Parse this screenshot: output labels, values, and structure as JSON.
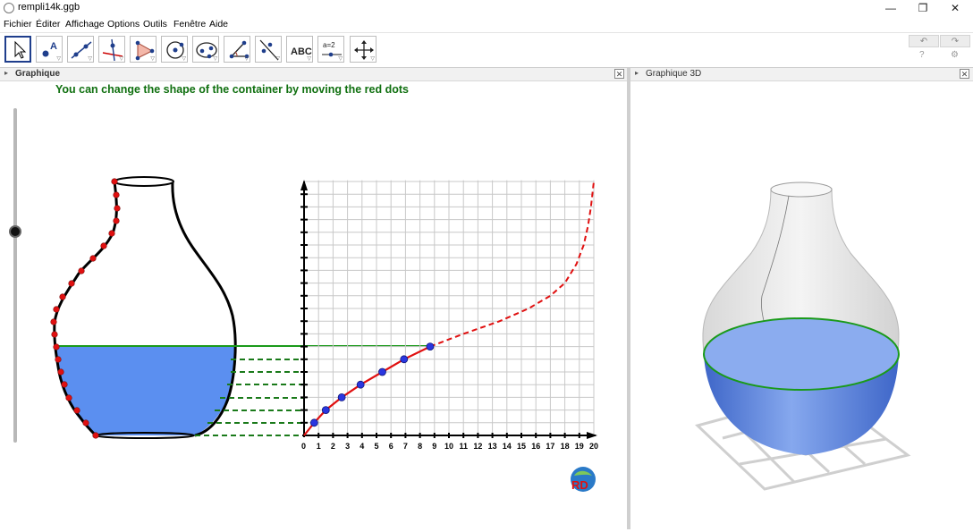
{
  "window": {
    "title": "rempli14k.ggb",
    "minimize": "—",
    "restore": "❐",
    "close": "✕"
  },
  "menu": [
    "Fichier",
    "Éditer",
    "Affichage",
    "Options",
    "Outils",
    "Fenêtre",
    "Aide"
  ],
  "toolbar": {
    "tools": [
      "move-tool",
      "point-tool",
      "line-tool",
      "perpendicular-tool",
      "polygon-tool",
      "circle-tool",
      "conic-tool",
      "angle-tool",
      "reflect-tool",
      "text-tool",
      "slider-tool",
      "move-view-tool"
    ],
    "text_tool_label": "ABC",
    "slider_tool_label": "a=2",
    "undo": "↶",
    "redo": "↷",
    "help": "?",
    "settings": "⚙"
  },
  "panels": {
    "graphics": "Graphique",
    "graphics3d": "Graphique 3D",
    "close": "✕",
    "toggle": "▸"
  },
  "graphics": {
    "caption": "You can change the shape of the container by moving the red dots",
    "slider_value_fraction": 0.63
  },
  "chart_data": {
    "type": "line",
    "x_ticks": [
      "0",
      "1",
      "2",
      "3",
      "4",
      "5",
      "6",
      "7",
      "8",
      "9",
      "10",
      "11",
      "12",
      "13",
      "14",
      "15",
      "16",
      "17",
      "18",
      "19",
      "20"
    ],
    "series": [
      {
        "style": "solid",
        "color": "#e01010",
        "points": [
          [
            0,
            0
          ],
          [
            0.7,
            1
          ],
          [
            1.5,
            2
          ],
          [
            2.6,
            3
          ],
          [
            3.9,
            4
          ],
          [
            5.4,
            5
          ],
          [
            6.9,
            6
          ],
          [
            8.7,
            7
          ]
        ]
      },
      {
        "style": "dashed",
        "color": "#e01010",
        "points": [
          [
            8.7,
            7
          ],
          [
            11,
            8
          ],
          [
            13.5,
            9
          ],
          [
            15.5,
            10
          ],
          [
            17,
            11
          ],
          [
            18,
            12
          ],
          [
            18.8,
            13.5
          ],
          [
            19.3,
            15
          ],
          [
            19.6,
            16.5
          ],
          [
            19.8,
            18
          ],
          [
            20,
            20
          ]
        ]
      }
    ],
    "fill_markers": [
      [
        0.7,
        1
      ],
      [
        1.5,
        2
      ],
      [
        2.6,
        3
      ],
      [
        3.9,
        4
      ],
      [
        5.4,
        5
      ],
      [
        6.9,
        6
      ],
      [
        8.7,
        7
      ]
    ],
    "xlim": [
      0,
      20
    ],
    "grid": true
  },
  "colors": {
    "water": "#5b8ff0",
    "level_line": "#1a9a1a",
    "curve": "#e01010",
    "marker": "#2a36e0",
    "caption": "#107010"
  }
}
